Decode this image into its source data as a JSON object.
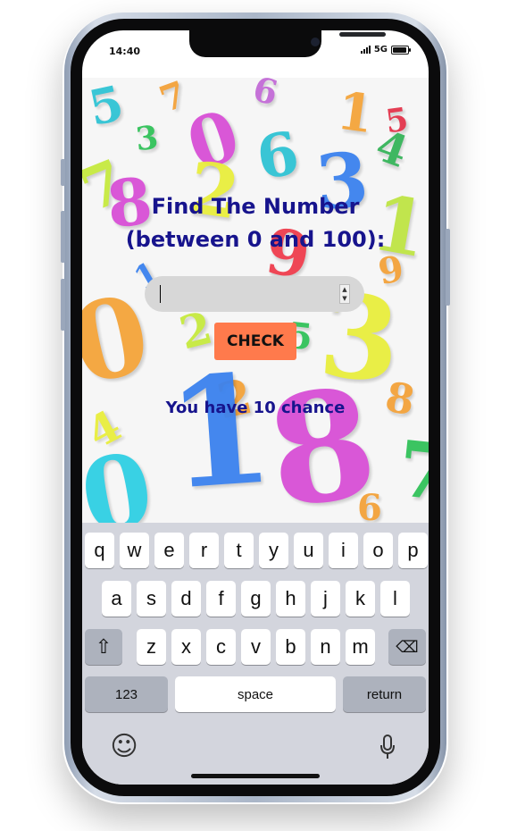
{
  "status_bar": {
    "time": "14:40",
    "network": "5G"
  },
  "page": {
    "title_line1": "Find The Number",
    "title_line2": "(between 0 and 100):",
    "input_value": "",
    "check_button": "CHECK",
    "chance_text": "You have 10 chance"
  },
  "keyboard": {
    "row1": [
      "q",
      "w",
      "e",
      "r",
      "t",
      "y",
      "u",
      "i",
      "o",
      "p"
    ],
    "row2": [
      "a",
      "s",
      "d",
      "f",
      "g",
      "h",
      "j",
      "k",
      "l"
    ],
    "row3": [
      "z",
      "x",
      "c",
      "v",
      "b",
      "n",
      "m"
    ],
    "shift_icon": "⇧",
    "backspace_icon": "⌫",
    "numbers_label": "123",
    "space_label": "space",
    "return_label": "return",
    "emoji_icon": "☺",
    "mic_icon": "microphone-icon"
  },
  "colors": {
    "title": "#17148d",
    "check_button": "#ff7a4c",
    "input_bg": "#d7d7d7",
    "keyboard_bg": "#d3d5dd"
  }
}
